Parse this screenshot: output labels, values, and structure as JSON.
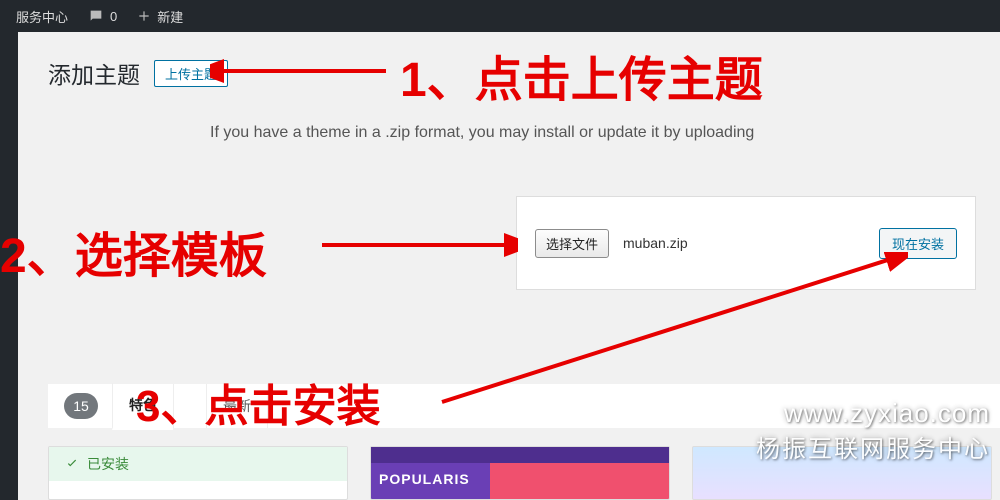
{
  "adminbar": {
    "service_center": "服务中心",
    "comments_count": "0",
    "new_label": "新建"
  },
  "page": {
    "title": "添加主题",
    "upload_button": "上传主题",
    "hint": "If you have a theme in a .zip format, you may install or update it by uploading"
  },
  "upload": {
    "choose_label": "选择文件",
    "filename": "muban.zip",
    "install_label": "现在安装"
  },
  "filter": {
    "count": "15",
    "tabs": [
      "特色",
      "",
      "最新",
      ""
    ]
  },
  "themes": {
    "installed_label": "已安装",
    "thumb2_brand": "POPULARIS"
  },
  "annotations": {
    "a1": "1、点击上传主题",
    "a2": "2、选择模板",
    "a3": "3、点击安装"
  },
  "watermark": {
    "url": "www.zyxiao.com",
    "name": "杨振互联网服务中心"
  }
}
